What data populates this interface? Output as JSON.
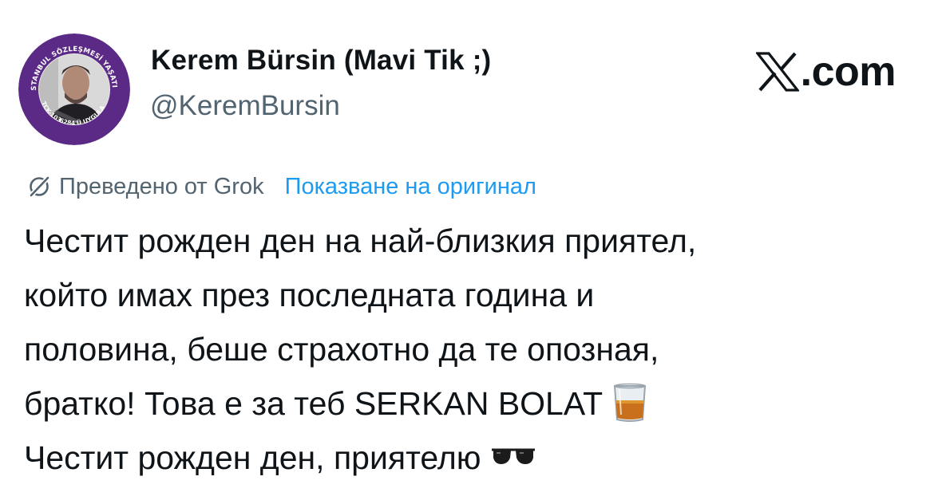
{
  "profile": {
    "display_name": "Kerem Bürsin (Mavi Tik ;)",
    "handle": "@KeremBursin",
    "avatar_badge_top": "İSTANBUL SÖZLEŞMESİ YAŞATIR",
    "avatar_badge_left": "TCK-103",
    "avatar_badge_bottom": "6284'Ü UYGULA",
    "avatar_ring_color": "#5b2a86",
    "avatar_icon": "profile-photo"
  },
  "brand": {
    "logo_icon": "x-logo-icon",
    "tld": ".com"
  },
  "translation": {
    "icon": "grok-icon",
    "translated_label": "Преведено от Grok",
    "show_original_label": "Показване на оригинал",
    "link_color": "#1d9bf0"
  },
  "tweet": {
    "lines": [
      "Честит рожден ден на най-близкия приятел,",
      "който имах през последната година и",
      "половина, беше страхотно да те опозная,",
      "братко! Това е за теб SERKAN BOLAT",
      "Честит рожден ден, приятелю"
    ],
    "emojis": [
      "tumbler-glass-icon",
      "sunglasses-icon"
    ]
  }
}
